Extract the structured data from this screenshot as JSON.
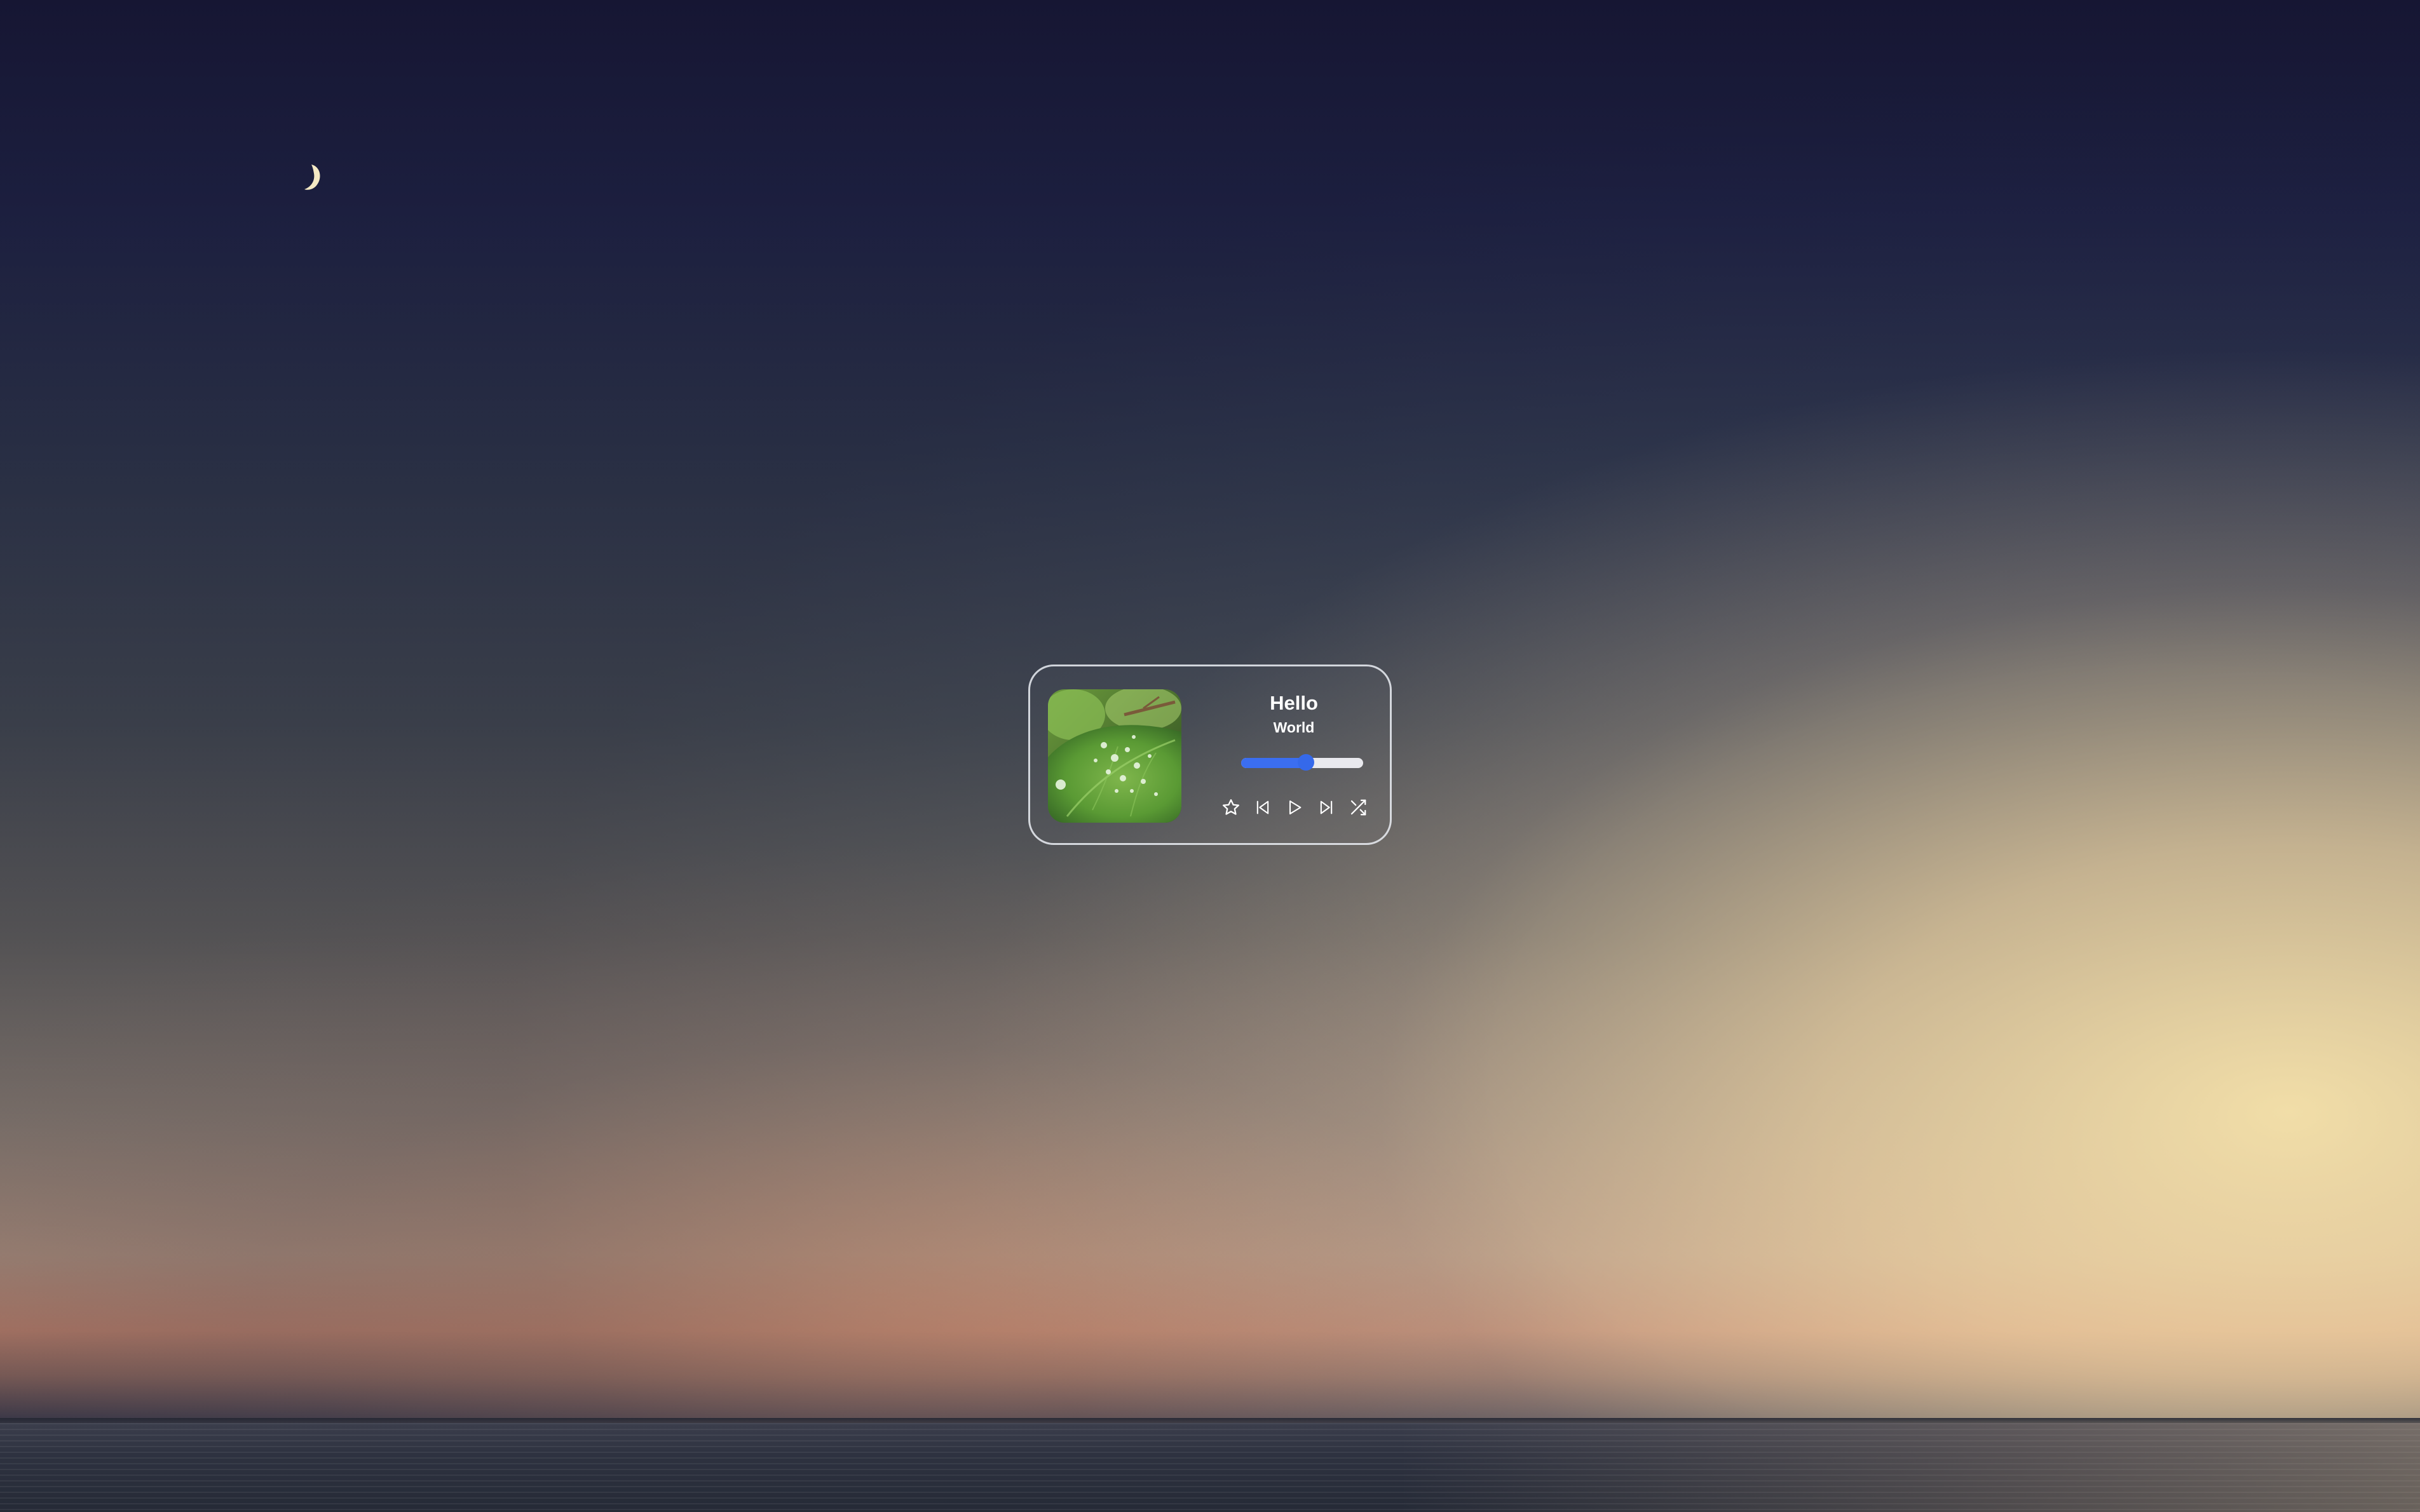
{
  "track": {
    "title": "Hello",
    "artist": "World"
  },
  "progress": {
    "value_fraction": 0.53,
    "fill_color": "#3b6ef0",
    "track_color": "#e9e9ee"
  },
  "controls": [
    {
      "name": "favorite-button",
      "icon": "star-icon"
    },
    {
      "name": "previous-button",
      "icon": "skip-back-icon"
    },
    {
      "name": "play-button",
      "icon": "play-icon"
    },
    {
      "name": "next-button",
      "icon": "skip-forward-icon"
    },
    {
      "name": "shuffle-button",
      "icon": "shuffle-icon"
    }
  ],
  "album_art": {
    "icon": "leaf-with-water-drops-image"
  },
  "theme": {
    "card_border": "#ebeef5",
    "text_color": "#ffffff"
  }
}
